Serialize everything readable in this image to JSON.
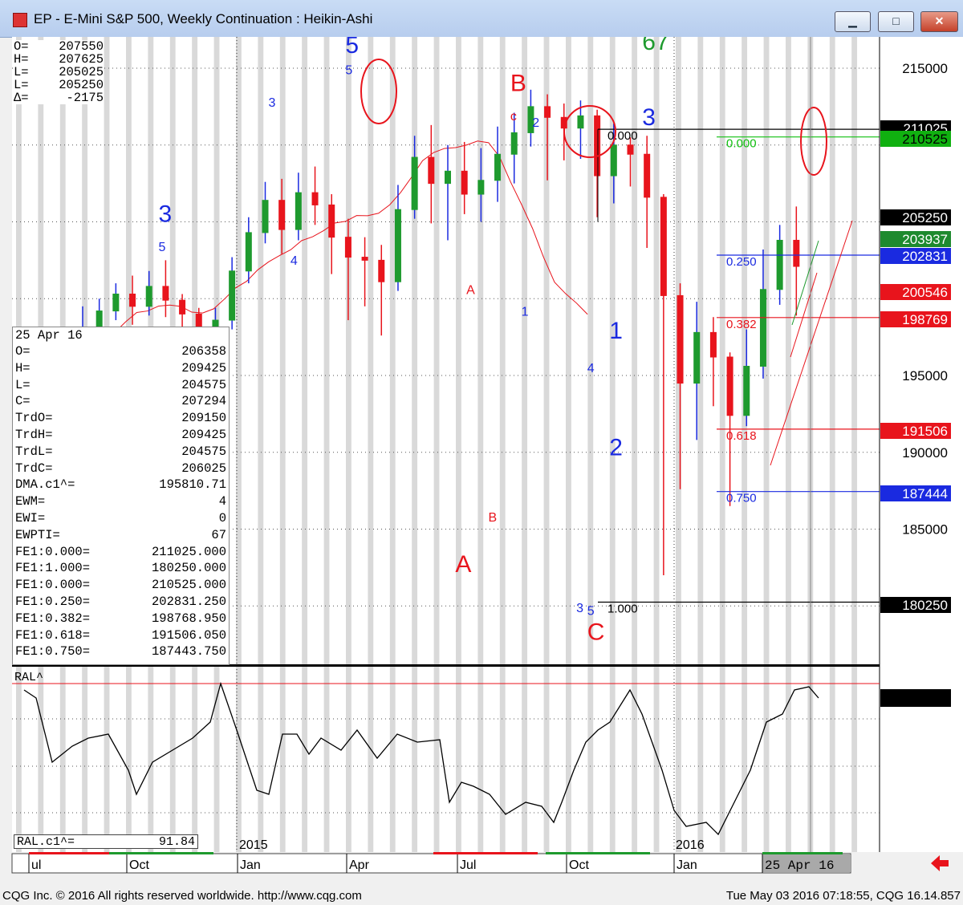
{
  "window": {
    "title": "EP - E-Mini S&P 500, Weekly Continuation : Heikin-Ashi",
    "minimize_label": "▁",
    "maximize_label": "□",
    "close_label": "✕"
  },
  "ohlc_header": [
    {
      "label": "O=",
      "value": "207550"
    },
    {
      "label": "H=",
      "value": "207625"
    },
    {
      "label": "L=",
      "value": "205025"
    },
    {
      "label": "L=",
      "value": "205250"
    },
    {
      "label": "Δ=",
      "value": "-2175"
    }
  ],
  "data_window": {
    "date": "25 Apr 16",
    "rows": [
      {
        "label": "O=",
        "value": "206358"
      },
      {
        "label": "H=",
        "value": "209425"
      },
      {
        "label": "L=",
        "value": "204575"
      },
      {
        "label": "C=",
        "value": "207294"
      },
      {
        "label": "TrdO=",
        "value": "209150"
      },
      {
        "label": "TrdH=",
        "value": "209425"
      },
      {
        "label": "TrdL=",
        "value": "204575"
      },
      {
        "label": "TrdC=",
        "value": "206025"
      },
      {
        "label": "DMA.c1^=",
        "value": "195810.71"
      },
      {
        "label": "EWM=",
        "value": "4"
      },
      {
        "label": "EWI=",
        "value": "0"
      },
      {
        "label": "EWPTI=",
        "value": "67"
      },
      {
        "label": "FE1:0.000=",
        "value": "211025.000"
      },
      {
        "label": "FE1:1.000=",
        "value": "180250.000"
      },
      {
        "label": "FE1:0.000=",
        "value": "210525.000"
      },
      {
        "label": "FE1:0.250=",
        "value": "202831.250"
      },
      {
        "label": "FE1:0.382=",
        "value": "198768.950"
      },
      {
        "label": "FE1:0.618=",
        "value": "191506.050"
      },
      {
        "label": "FE1:0.750=",
        "value": "187443.750"
      }
    ]
  },
  "ral_readout": {
    "label": "RAL.c1^=",
    "value": "91.84"
  },
  "ral_title": "RAL^",
  "status": {
    "left": "CQG Inc. © 2016 All rights reserved worldwide. http://www.cqg.com",
    "right": "Tue May 03 2016 07:18:55, CQG 16.14.857"
  },
  "colors": {
    "up": "#1e9a2e",
    "down": "#e8141c",
    "wave": "#1a2ae0",
    "ma": "#e8141c",
    "grid_band": "#d9d9d9"
  },
  "chart_data": {
    "type": "candlestick",
    "style": "Heikin-Ashi",
    "price_axis": {
      "ticks": [
        215000,
        195000,
        190000,
        185000
      ],
      "range": [
        176000,
        216500
      ]
    },
    "price_axis_labels": [
      "215000",
      "195000",
      "190000",
      "185000"
    ],
    "time_axis": {
      "labels": [
        "ul",
        "Oct",
        "Jan",
        "Apr",
        "Jul",
        "Oct",
        "Jan",
        "25 Apr 16"
      ],
      "year_labels": [
        "2015",
        "2016"
      ]
    },
    "price_flags": [
      {
        "value": "211025",
        "bg": "#000000",
        "fg": "#ffffff"
      },
      {
        "value": "210525",
        "bg": "#10b010",
        "fg": "#000000"
      },
      {
        "value": "205250",
        "bg": "#000000",
        "fg": "#ffffff"
      },
      {
        "value": "203937",
        "bg": "#1e8a2e",
        "fg": "#ffffff"
      },
      {
        "value": "202831",
        "bg": "#1a2ae0",
        "fg": "#ffffff"
      },
      {
        "value": "200546",
        "bg": "#e8141c",
        "fg": "#ffffff"
      },
      {
        "value": "198769",
        "bg": "#e8141c",
        "fg": "#ffffff"
      },
      {
        "value": "191506",
        "bg": "#e8141c",
        "fg": "#ffffff"
      },
      {
        "value": "187444",
        "bg": "#1a2ae0",
        "fg": "#ffffff"
      },
      {
        "value": "180250",
        "bg": "#000000",
        "fg": "#ffffff"
      }
    ],
    "fib_levels": [
      {
        "label": "0.000",
        "price": 211025,
        "color": "#000000"
      },
      {
        "label": "0.000",
        "price": 210525,
        "color": "#10c010"
      },
      {
        "label": "0.250",
        "price": 202831,
        "color": "#1a2ae0"
      },
      {
        "label": "0.382",
        "price": 198769,
        "color": "#e8141c"
      },
      {
        "label": "0.618",
        "price": 191506,
        "color": "#e8141c"
      },
      {
        "label": "0.750",
        "price": 187444,
        "color": "#1a2ae0"
      },
      {
        "label": "1.000",
        "price": 180250,
        "color": "#000000"
      }
    ],
    "wave_labels": [
      {
        "text": "3",
        "week": 5,
        "price": 205000,
        "color": "#1a2ae0",
        "big": true
      },
      {
        "text": "5",
        "week": 5,
        "price": 203100,
        "color": "#1a2ae0"
      },
      {
        "text": "3",
        "week": 15,
        "price": 212500,
        "color": "#1a2ae0"
      },
      {
        "text": "4",
        "week": 17,
        "price": 202200,
        "color": "#1a2ae0"
      },
      {
        "text": "5",
        "week": 22,
        "price": 216000,
        "color": "#1a2ae0",
        "big": true
      },
      {
        "text": "5",
        "week": 22,
        "price": 214600,
        "color": "#1a2ae0"
      },
      {
        "text": "A",
        "week": 33,
        "price": 200300,
        "color": "#e8141c"
      },
      {
        "text": "A",
        "week": 32,
        "price": 182200,
        "color": "#e8141c",
        "big": true
      },
      {
        "text": "B",
        "week": 35,
        "price": 185500,
        "color": "#e8141c"
      },
      {
        "text": "B",
        "week": 37,
        "price": 213500,
        "color": "#e8141c",
        "big": true
      },
      {
        "text": "c",
        "week": 37,
        "price": 211600,
        "color": "#e8141c"
      },
      {
        "text": "2",
        "week": 39,
        "price": 211200,
        "color": "#1a2ae0"
      },
      {
        "text": "1",
        "week": 38,
        "price": 198900,
        "color": "#1a2ae0"
      },
      {
        "text": "4",
        "week": 44,
        "price": 195200,
        "color": "#1a2ae0"
      },
      {
        "text": "3",
        "week": 43,
        "price": 179600,
        "color": "#1a2ae0"
      },
      {
        "text": "5",
        "week": 44,
        "price": 179400,
        "color": "#1a2ae0"
      },
      {
        "text": "C",
        "week": 44,
        "price": 177800,
        "color": "#e8141c",
        "big": true
      },
      {
        "text": "1",
        "week": 46,
        "price": 197400,
        "color": "#1a2ae0",
        "big": true
      },
      {
        "text": "2",
        "week": 46,
        "price": 189800,
        "color": "#1a2ae0",
        "big": true
      },
      {
        "text": "3",
        "week": 49,
        "price": 211300,
        "color": "#1a2ae0",
        "big": true
      },
      {
        "text": "67",
        "week": 49,
        "price": 216200,
        "color": "#1e9a2e",
        "big": true
      }
    ],
    "candles": [
      {
        "o": 196500,
        "c": 197800,
        "h": 199500,
        "l": 195800
      },
      {
        "o": 197800,
        "c": 199200,
        "h": 200000,
        "l": 197000
      },
      {
        "o": 199200,
        "c": 200300,
        "h": 201000,
        "l": 198600
      },
      {
        "o": 200300,
        "c": 199500,
        "h": 201500,
        "l": 198300
      },
      {
        "o": 199500,
        "c": 200800,
        "h": 201800,
        "l": 198900
      },
      {
        "o": 200800,
        "c": 199900,
        "h": 202500,
        "l": 198800
      },
      {
        "o": 199900,
        "c": 199000,
        "h": 200300,
        "l": 197500
      },
      {
        "o": 199000,
        "c": 196500,
        "h": 199400,
        "l": 194800
      },
      {
        "o": 196500,
        "c": 198600,
        "h": 199400,
        "l": 195800
      },
      {
        "o": 198600,
        "c": 201800,
        "h": 202700,
        "l": 198000
      },
      {
        "o": 201800,
        "c": 204300,
        "h": 205300,
        "l": 201000
      },
      {
        "o": 204300,
        "c": 206400,
        "h": 207600,
        "l": 203600
      },
      {
        "o": 206400,
        "c": 204500,
        "h": 207800,
        "l": 202900
      },
      {
        "o": 204500,
        "c": 206900,
        "h": 208200,
        "l": 203800
      },
      {
        "o": 206900,
        "c": 206100,
        "h": 208600,
        "l": 204800
      },
      {
        "o": 206100,
        "c": 204000,
        "h": 206800,
        "l": 201600
      },
      {
        "o": 204000,
        "c": 202700,
        "h": 205200,
        "l": 198600
      },
      {
        "o": 202700,
        "c": 202500,
        "h": 204000,
        "l": 199500
      },
      {
        "o": 202500,
        "c": 201100,
        "h": 203500,
        "l": 197600
      },
      {
        "o": 201100,
        "c": 205800,
        "h": 207400,
        "l": 200500
      },
      {
        "o": 205800,
        "c": 209200,
        "h": 210600,
        "l": 205200
      },
      {
        "o": 209200,
        "c": 207500,
        "h": 211300,
        "l": 204900
      },
      {
        "o": 207500,
        "c": 208300,
        "h": 210000,
        "l": 203800
      },
      {
        "o": 208300,
        "c": 206800,
        "h": 210200,
        "l": 205500
      },
      {
        "o": 206800,
        "c": 207700,
        "h": 209800,
        "l": 205000
      },
      {
        "o": 207700,
        "c": 209400,
        "h": 211200,
        "l": 206300
      },
      {
        "o": 209400,
        "c": 210800,
        "h": 212100,
        "l": 207500
      },
      {
        "o": 210800,
        "c": 212500,
        "h": 213600,
        "l": 209900
      },
      {
        "o": 212500,
        "c": 211800,
        "h": 213300,
        "l": 207700
      },
      {
        "o": 211800,
        "c": 211100,
        "h": 212700,
        "l": 209000
      },
      {
        "o": 211100,
        "c": 211900,
        "h": 212900,
        "l": 209100
      },
      {
        "o": 211900,
        "c": 208000,
        "h": 212300,
        "l": 205300
      },
      {
        "o": 208000,
        "c": 210000,
        "h": 211400,
        "l": 206200
      },
      {
        "o": 210000,
        "c": 209400,
        "h": 210500,
        "l": 207300
      },
      {
        "o": 209400,
        "c": 206600,
        "h": 210600,
        "l": 203300
      },
      {
        "o": 206600,
        "c": 200200,
        "h": 206800,
        "l": 182000
      },
      {
        "o": 200200,
        "c": 194500,
        "h": 201000,
        "l": 187600
      },
      {
        "o": 194500,
        "c": 197800,
        "h": 199800,
        "l": 190800
      },
      {
        "o": 197800,
        "c": 196200,
        "h": 198800,
        "l": 193000
      },
      {
        "o": 196200,
        "c": 192400,
        "h": 196500,
        "l": 186500
      },
      {
        "o": 192400,
        "c": 195600,
        "h": 198000,
        "l": 191700
      },
      {
        "o": 195600,
        "c": 200600,
        "h": 203200,
        "l": 194800
      },
      {
        "o": 200600,
        "c": 203800,
        "h": 204800,
        "l": 199600
      },
      {
        "o": 203800,
        "c": 202100,
        "h": 206000,
        "l": 198900
      }
    ]
  }
}
